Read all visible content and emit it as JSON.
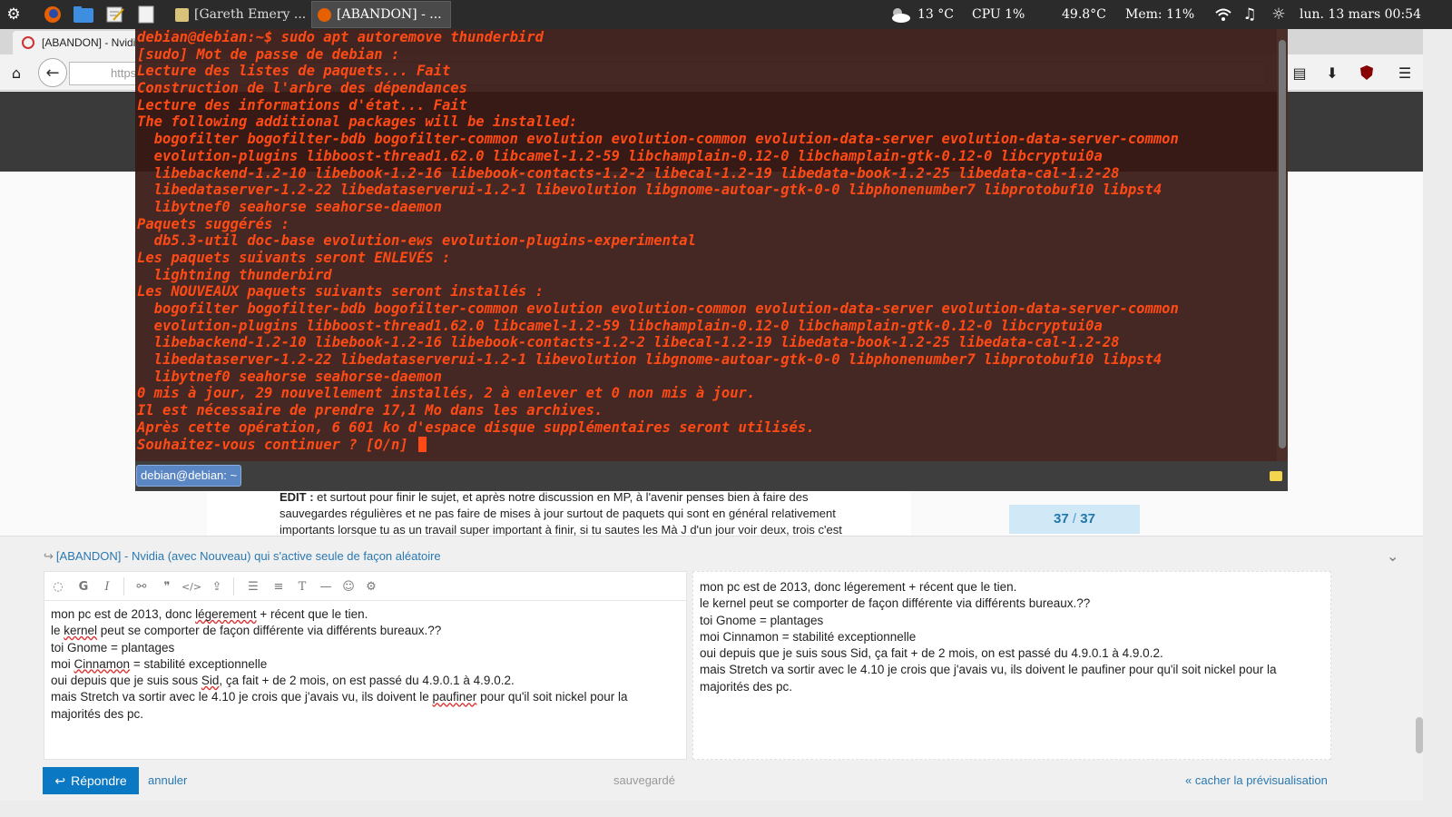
{
  "panel": {
    "tasks": [
      "[Gareth Emery ...",
      "[ABANDON] - ..."
    ],
    "weather_temp": "13 °C",
    "cpu": "CPU 1%",
    "cpu_temp": "49.8°C",
    "mem": "Mem:  11%",
    "datetime": "lun. 13 mars 00:54"
  },
  "browser": {
    "tab_title": "[ABANDON] - Nvidi",
    "url_partial": "https",
    "post_edit_label": "EDIT :",
    "post_edit_text": " et surtout pour finir le sujet, et après notre discussion en MP, à l'avenir penses bien à faire des sauvegardes régulières et ne pas faire de mises à jour surtout de paquets qui sont en général relativement importants lorsque tu as un travail super important à finir, si tu sautes les Mà J d'un jour voir deux, trois c'est",
    "pager_current": "37",
    "pager_sep": "/",
    "pager_total": "37"
  },
  "terminal": {
    "lines": [
      "debian@debian:~$ sudo apt autoremove thunderbird",
      "[sudo] Mot de passe de debian :",
      "Lecture des listes de paquets... Fait",
      "Construction de l'arbre des dépendances",
      "Lecture des informations d'état... Fait",
      "The following additional packages will be installed:",
      "  bogofilter bogofilter-bdb bogofilter-common evolution evolution-common evolution-data-server evolution-data-server-common",
      "  evolution-plugins libboost-thread1.62.0 libcamel-1.2-59 libchamplain-0.12-0 libchamplain-gtk-0.12-0 libcryptui0a",
      "  libebackend-1.2-10 libebook-1.2-16 libebook-contacts-1.2-2 libecal-1.2-19 libedata-book-1.2-25 libedata-cal-1.2-28",
      "  libedataserver-1.2-22 libedataserverui-1.2-1 libevolution libgnome-autoar-gtk-0-0 libphonenumber7 libprotobuf10 libpst4",
      "  libytnef0 seahorse seahorse-daemon",
      "Paquets suggérés :",
      "  db5.3-util doc-base evolution-ews evolution-plugins-experimental",
      "Les paquets suivants seront ENLEVÉS :",
      "  lightning thunderbird",
      "Les NOUVEAUX paquets suivants seront installés :",
      "  bogofilter bogofilter-bdb bogofilter-common evolution evolution-common evolution-data-server evolution-data-server-common",
      "  evolution-plugins libboost-thread1.62.0 libcamel-1.2-59 libchamplain-0.12-0 libchamplain-gtk-0.12-0 libcryptui0a",
      "  libebackend-1.2-10 libebook-1.2-16 libebook-contacts-1.2-2 libecal-1.2-19 libedata-book-1.2-25 libedata-cal-1.2-28",
      "  libedataserver-1.2-22 libedataserverui-1.2-1 libevolution libgnome-autoar-gtk-0-0 libphonenumber7 libprotobuf10 libpst4",
      "  libytnef0 seahorse seahorse-daemon",
      "0 mis à jour, 29 nouvellement installés, 2 à enlever et 0 non mis à jour.",
      "Il est nécessaire de prendre 17,1 Mo dans les archives.",
      "Après cette opération, 6 601 ko d'espace disque supplémentaires seront utilisés.",
      "Souhaitez-vous continuer ? [O/n] "
    ],
    "tab_label": "debian@debian: ~",
    "text_color": "#ff4a15"
  },
  "composer": {
    "reply_title": "[ABANDON] - Nvidia (avec Nouveau) qui s'active seule de façon aléatoire",
    "editor_lines": [
      [
        "mon pc est de 2013, donc ",
        "légerement",
        " + récent que le tien."
      ],
      [
        "le ",
        "kernel",
        " peut se comporter de façon différente via différents bureaux.??"
      ],
      [
        "toi Gnome = plantages"
      ],
      [
        "moi ",
        "Cinnamon",
        " = stabilité exceptionnelle"
      ],
      [
        "oui depuis que je suis sous ",
        "Sid",
        ", ça fait + de 2 mois, on est passé du 4.9.0.1 à 4.9.0.2."
      ],
      [
        "mais Stretch va sortir avec le 4.10 je crois que j'avais vu, ils doivent le ",
        "paufiner",
        " pour qu'il soit nickel pour la majorités des pc."
      ]
    ],
    "preview_lines": [
      "mon pc est de 2013, donc légerement + récent que le tien.",
      "le kernel peut se comporter de façon différente via différents bureaux.??",
      "toi Gnome = plantages",
      "moi Cinnamon = stabilité exceptionnelle",
      "oui depuis que je suis sous Sid, ça fait + de 2 mois, on est passé du 4.9.0.1 à 4.9.0.2.",
      "mais Stretch va sortir avec le 4.10 je crois que j'avais vu, ils doivent le paufiner pour qu'il soit nickel pour la majorités des pc."
    ],
    "reply_button": "Répondre",
    "cancel_link": "annuler",
    "saved_status": "sauvegardé",
    "hide_preview_link": "« cacher la prévisualisation",
    "accent_color": "#0a78c2"
  }
}
